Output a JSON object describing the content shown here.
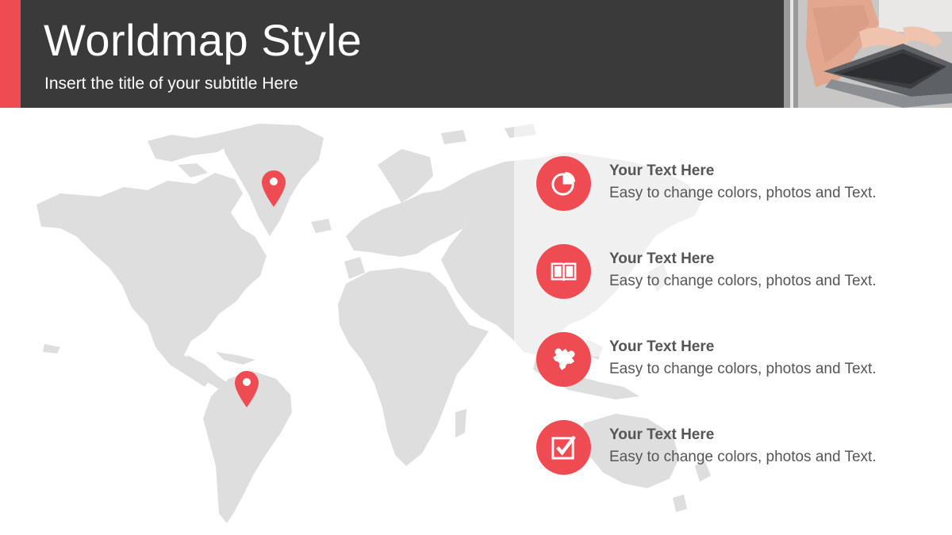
{
  "header": {
    "title": "Worldmap Style",
    "subtitle": "Insert the title of your subtitle Here"
  },
  "colors": {
    "accent": "#ef4b52",
    "header_bg": "#3a3a3a",
    "map_land": "#dedede",
    "text": "#555555"
  },
  "photo": {
    "description_icon": "laptop-typing-photo"
  },
  "map": {
    "pins": [
      {
        "name": "greenland-pin",
        "icon": "location-pin-icon"
      },
      {
        "name": "south-america-pin",
        "icon": "location-pin-icon"
      }
    ]
  },
  "features": [
    {
      "title": "Your Text  Here",
      "description": "Easy to change colors, photos and Text.",
      "icon": "pie-chart-icon"
    },
    {
      "title": "Your Text  Here",
      "description": "Easy to change colors, photos and Text.",
      "icon": "book-icon"
    },
    {
      "title": "Your Text  Here",
      "description": "Easy to change colors, photos and Text.",
      "icon": "puzzle-icon"
    },
    {
      "title": "Your Text  Here",
      "description": "Easy to change colors, photos and Text.",
      "icon": "checkbox-icon"
    }
  ]
}
